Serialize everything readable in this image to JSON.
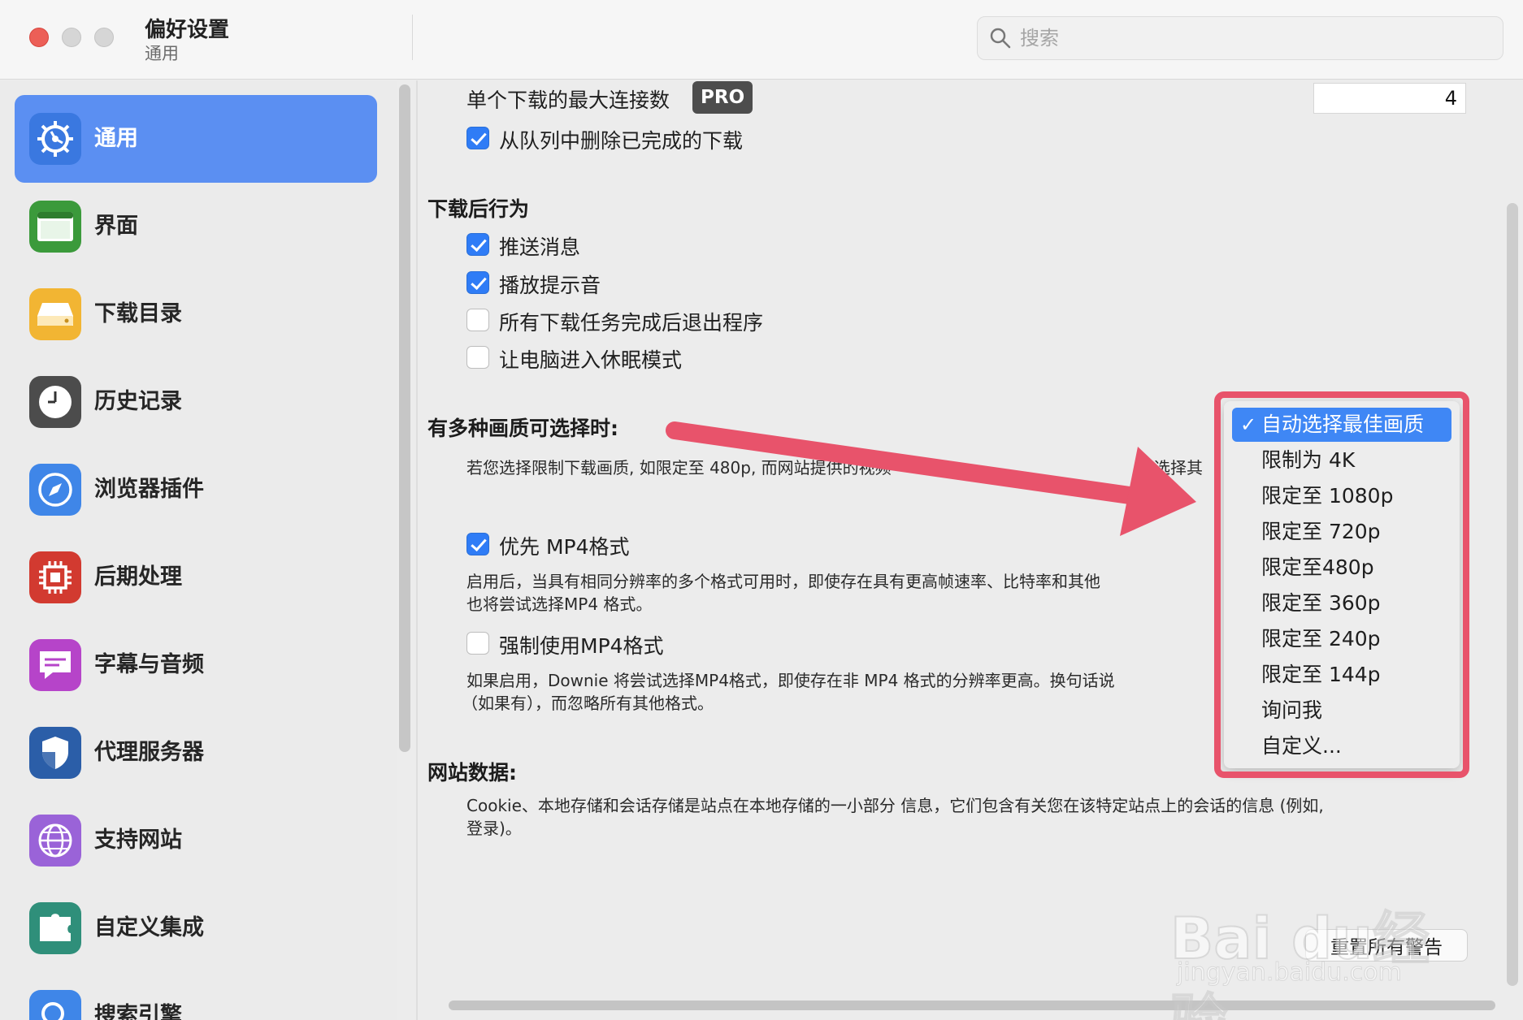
{
  "window": {
    "title": "偏好设置",
    "subtitle": "通用"
  },
  "search": {
    "placeholder": "搜索"
  },
  "sidebar": {
    "items": [
      {
        "label": "通用",
        "icon": "gear-icon",
        "color": "#3a78e0",
        "active": true
      },
      {
        "label": "界面",
        "icon": "window-icon",
        "color": "#3b9a3b"
      },
      {
        "label": "下载目录",
        "icon": "drive-icon",
        "color": "#f2b533"
      },
      {
        "label": "历史记录",
        "icon": "clock-icon",
        "color": "#4c4c4c"
      },
      {
        "label": "浏览器插件",
        "icon": "compass-icon",
        "color": "#3f86e8"
      },
      {
        "label": "后期处理",
        "icon": "chip-icon",
        "color": "#d23a30"
      },
      {
        "label": "字幕与音频",
        "icon": "caption-icon",
        "color": "#b644c9"
      },
      {
        "label": "代理服务器",
        "icon": "shield-icon",
        "color": "#2b5ea8"
      },
      {
        "label": "支持网站",
        "icon": "globe-icon",
        "color": "#9a63d8"
      },
      {
        "label": "自定义集成",
        "icon": "puzzle-icon",
        "color": "#2f8f7a"
      },
      {
        "label": "搜索引擎",
        "icon": "magnifier-icon",
        "color": "#3f86e8"
      }
    ]
  },
  "general": {
    "max_connections_label": "单个下载的最大连接数",
    "pro_badge": "PRO",
    "max_connections_value": "4",
    "remove_completed": {
      "label": "从队列中删除已完成的下载",
      "checked": true
    }
  },
  "after_download": {
    "title": "下载后行为",
    "options": [
      {
        "label": "推送消息",
        "checked": true
      },
      {
        "label": "播放提示音",
        "checked": true
      },
      {
        "label": "所有下载任务完成后退出程序",
        "checked": false
      },
      {
        "label": "让电脑进入休眠模式",
        "checked": false
      }
    ]
  },
  "quality": {
    "title": "有多种画质可选择时:",
    "description": "若您选择限制下载画质, 如限定至 480p, 而网站提供的视频",
    "description_tail": "将选择其",
    "prefer_mp4": {
      "label": "优先 MP4格式",
      "checked": true
    },
    "prefer_mp4_desc_1": "启用后，当具有相同分辨率的多个格式可用时，即使存在具有更高帧速率、比特率和其他",
    "prefer_mp4_desc_2": "也将尝试选择MP4 格式。",
    "force_mp4": {
      "label": "强制使用MP4格式",
      "checked": false
    },
    "force_mp4_desc_1": "如果启用，Downie 将尝试选择MP4格式，即使存在非 MP4 格式的分辨率更高。换句话说",
    "force_mp4_desc_2": "（如果有），而忽略所有其他格式。"
  },
  "quality_menu": {
    "items": [
      {
        "label": "自动选择最佳画质",
        "selected": true
      },
      {
        "label": "限制为 4K"
      },
      {
        "label": "限定至 1080p"
      },
      {
        "label": "限定至 720p"
      },
      {
        "label": "限定至480p"
      },
      {
        "label": "限定至 360p"
      },
      {
        "label": "限定至 240p"
      },
      {
        "label": "限定至 144p"
      },
      {
        "label": "询问我"
      },
      {
        "label": "自定义..."
      }
    ],
    "check_mark": "✓",
    "highlight_color": "#e8536b"
  },
  "website_data": {
    "title": "网站数据:",
    "desc_1": "Cookie、本地存储和会话存储是站点在本地存储的一小部分 信息，它们包含有关您在该特定站点上的会话的信息 (例如,",
    "desc_2": "登录)。"
  },
  "reset_button": "重置所有警告",
  "watermark": {
    "brand": "Bai du经验",
    "url": "jingyan.baidu.com"
  }
}
